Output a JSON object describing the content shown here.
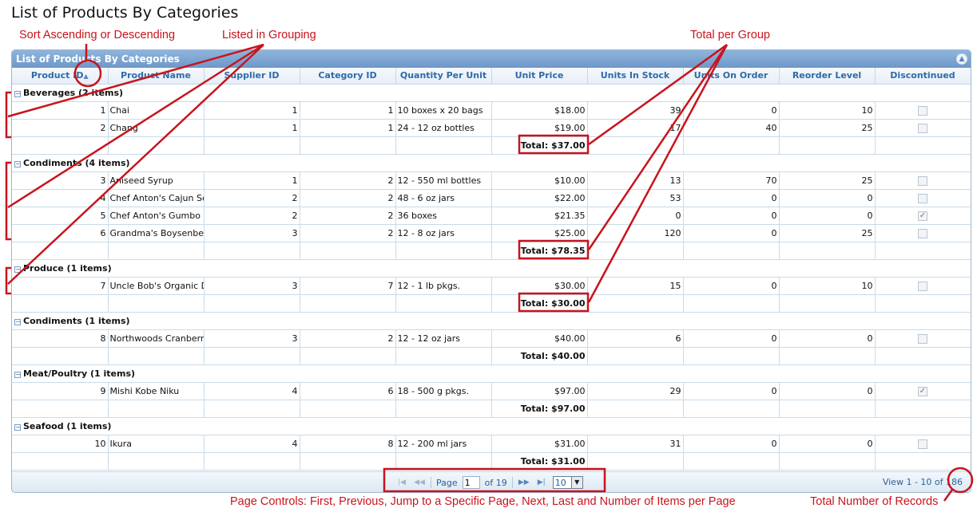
{
  "page_title": "List of Products By Categories",
  "annotations": {
    "sort": "Sort Ascending or Descending",
    "grouping": "Listed in Grouping",
    "total_group": "Total per Group",
    "page_controls": "Page Controls: First, Previous, Jump to a Specific Page, Next, Last and Number of Items per Page",
    "total_records": "Total Number of Records"
  },
  "grid": {
    "caption": "List of Products By Categories",
    "columns": [
      "Product ID",
      "Product Name",
      "Supplier ID",
      "Category ID",
      "Quantity Per Unit",
      "Unit Price",
      "Units In Stock",
      "Units On Order",
      "Reorder Level",
      "Discontinued"
    ],
    "groups": [
      {
        "label": "Beverages (2 items)",
        "total": "Total: $37.00",
        "rows": [
          {
            "id": "1",
            "name": "Chai",
            "supplier": "1",
            "category": "1",
            "qty": "10 boxes x 20 bags",
            "price": "$18.00",
            "stock": "39",
            "order": "0",
            "reorder": "10",
            "disc": false
          },
          {
            "id": "2",
            "name": "Chang",
            "supplier": "1",
            "category": "1",
            "qty": "24 - 12 oz bottles",
            "price": "$19.00",
            "stock": "17",
            "order": "40",
            "reorder": "25",
            "disc": false
          }
        ]
      },
      {
        "label": "Condiments (4 items)",
        "total": "Total: $78.35",
        "rows": [
          {
            "id": "3",
            "name": "Aniseed Syrup",
            "supplier": "1",
            "category": "2",
            "qty": "12 - 550 ml bottles",
            "price": "$10.00",
            "stock": "13",
            "order": "70",
            "reorder": "25",
            "disc": false
          },
          {
            "id": "4",
            "name": "Chef Anton's Cajun Seasoning",
            "supplier": "2",
            "category": "2",
            "qty": "48 - 6 oz jars",
            "price": "$22.00",
            "stock": "53",
            "order": "0",
            "reorder": "0",
            "disc": false
          },
          {
            "id": "5",
            "name": "Chef Anton's Gumbo Mix",
            "supplier": "2",
            "category": "2",
            "qty": "36 boxes",
            "price": "$21.35",
            "stock": "0",
            "order": "0",
            "reorder": "0",
            "disc": true
          },
          {
            "id": "6",
            "name": "Grandma's Boysenberry Spread",
            "supplier": "3",
            "category": "2",
            "qty": "12 - 8 oz jars",
            "price": "$25.00",
            "stock": "120",
            "order": "0",
            "reorder": "25",
            "disc": false
          }
        ]
      },
      {
        "label": "Produce (1 items)",
        "total": "Total: $30.00",
        "rows": [
          {
            "id": "7",
            "name": "Uncle Bob's Organic Dried Pears",
            "supplier": "3",
            "category": "7",
            "qty": "12 - 1 lb pkgs.",
            "price": "$30.00",
            "stock": "15",
            "order": "0",
            "reorder": "10",
            "disc": false
          }
        ]
      },
      {
        "label": "Condiments (1 items)",
        "total": "Total: $40.00",
        "rows": [
          {
            "id": "8",
            "name": "Northwoods Cranberry Sauce",
            "supplier": "3",
            "category": "2",
            "qty": "12 - 12 oz jars",
            "price": "$40.00",
            "stock": "6",
            "order": "0",
            "reorder": "0",
            "disc": false
          }
        ]
      },
      {
        "label": "Meat/Poultry (1 items)",
        "total": "Total: $97.00",
        "rows": [
          {
            "id": "9",
            "name": "Mishi Kobe Niku",
            "supplier": "4",
            "category": "6",
            "qty": "18 - 500 g pkgs.",
            "price": "$97.00",
            "stock": "29",
            "order": "0",
            "reorder": "0",
            "disc": true
          }
        ]
      },
      {
        "label": "Seafood (1 items)",
        "total": "Total: $31.00",
        "rows": [
          {
            "id": "10",
            "name": "Ikura",
            "supplier": "4",
            "category": "8",
            "qty": "12 - 200 ml jars",
            "price": "$31.00",
            "stock": "31",
            "order": "0",
            "reorder": "0",
            "disc": false
          }
        ]
      }
    ]
  },
  "pager": {
    "page_label": "Page",
    "page_value": "1",
    "of_label": "of 19",
    "per_page": "10",
    "view_info": "View 1 - 10 of 186"
  },
  "colors": {
    "annotation": "#c8141c",
    "header_text": "#2e6aa8",
    "caption_bg": "#7ea7d3"
  },
  "icons": [
    "sort-ascending-icon",
    "collapse-icon",
    "group-collapse-icon",
    "first-page-icon",
    "previous-page-icon",
    "next-page-icon",
    "last-page-icon",
    "dropdown-arrow-icon",
    "checkbox-icon"
  ]
}
